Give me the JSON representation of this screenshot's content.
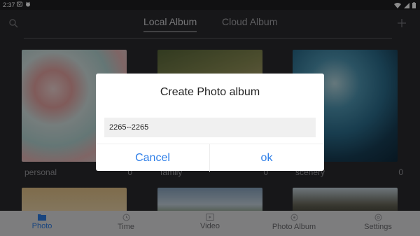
{
  "status_bar": {
    "time": "2:37",
    "icons": [
      "notification-icon",
      "cat-icon",
      "wifi-icon",
      "signal-icon",
      "battery-icon"
    ]
  },
  "header": {
    "tabs": [
      {
        "label": "Local Album",
        "active": true
      },
      {
        "label": "Cloud Album",
        "active": false
      }
    ],
    "icons": [
      "search-icon",
      "add-icon"
    ]
  },
  "albums": [
    {
      "name": "personal",
      "count": "0"
    },
    {
      "name": "family",
      "count": "0"
    },
    {
      "name": "scenery",
      "count": "0"
    },
    {
      "name": "",
      "count": ""
    },
    {
      "name": "",
      "count": ""
    },
    {
      "name": "",
      "count": ""
    }
  ],
  "dialog": {
    "title": "Create Photo album",
    "input_value": "2265--2265",
    "cancel_label": "Cancel",
    "ok_label": "ok"
  },
  "bottom_nav": {
    "items": [
      {
        "label": "Photo",
        "icon": "folder-icon",
        "active": true
      },
      {
        "label": "Time",
        "icon": "clock-icon",
        "active": false
      },
      {
        "label": "Video",
        "icon": "video-icon",
        "active": false
      },
      {
        "label": "Photo Album",
        "icon": "album-icon",
        "active": false
      },
      {
        "label": "Settings",
        "icon": "gear-icon",
        "active": false
      }
    ]
  },
  "colors": {
    "accent": "#2f7fe8",
    "background": "#2b2b2e",
    "nav_background": "#e3e3e5",
    "dialog_background": "#ffffff"
  }
}
